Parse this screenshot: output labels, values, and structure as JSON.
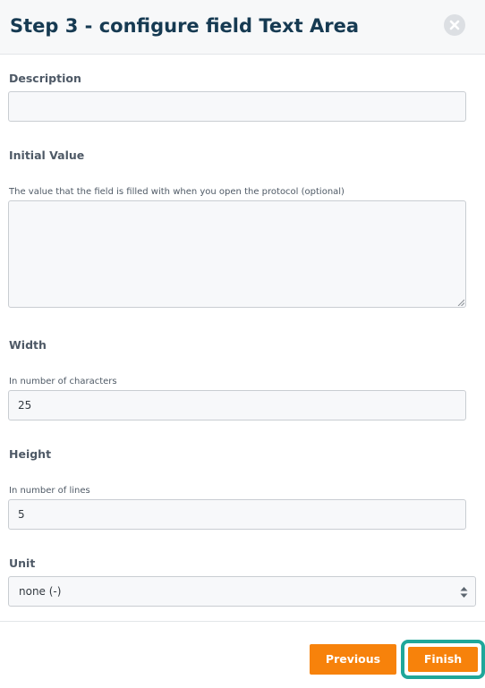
{
  "dialog": {
    "title": "Step 3 - configure field Text Area",
    "close_icon": "close-circle-icon"
  },
  "fields": {
    "description": {
      "label": "Description",
      "value": ""
    },
    "initial_value": {
      "label": "Initial Value",
      "hint": "The value that the field is filled with when you open the protocol (optional)",
      "value": ""
    },
    "width": {
      "label": "Width",
      "hint": "In number of characters",
      "value": "25"
    },
    "height": {
      "label": "Height",
      "hint": "In number of lines",
      "value": "5"
    },
    "unit": {
      "label": "Unit",
      "selected": "none (-)",
      "arrow_icon": "updown-arrows-icon"
    }
  },
  "footer": {
    "previous_label": "Previous",
    "finish_label": "Finish"
  },
  "colors": {
    "accent": "#f7820b",
    "title": "#163a52",
    "focus": "#1fa79a",
    "header_bg": "#f7f8f9",
    "input_bg": "#f7f8fa"
  }
}
